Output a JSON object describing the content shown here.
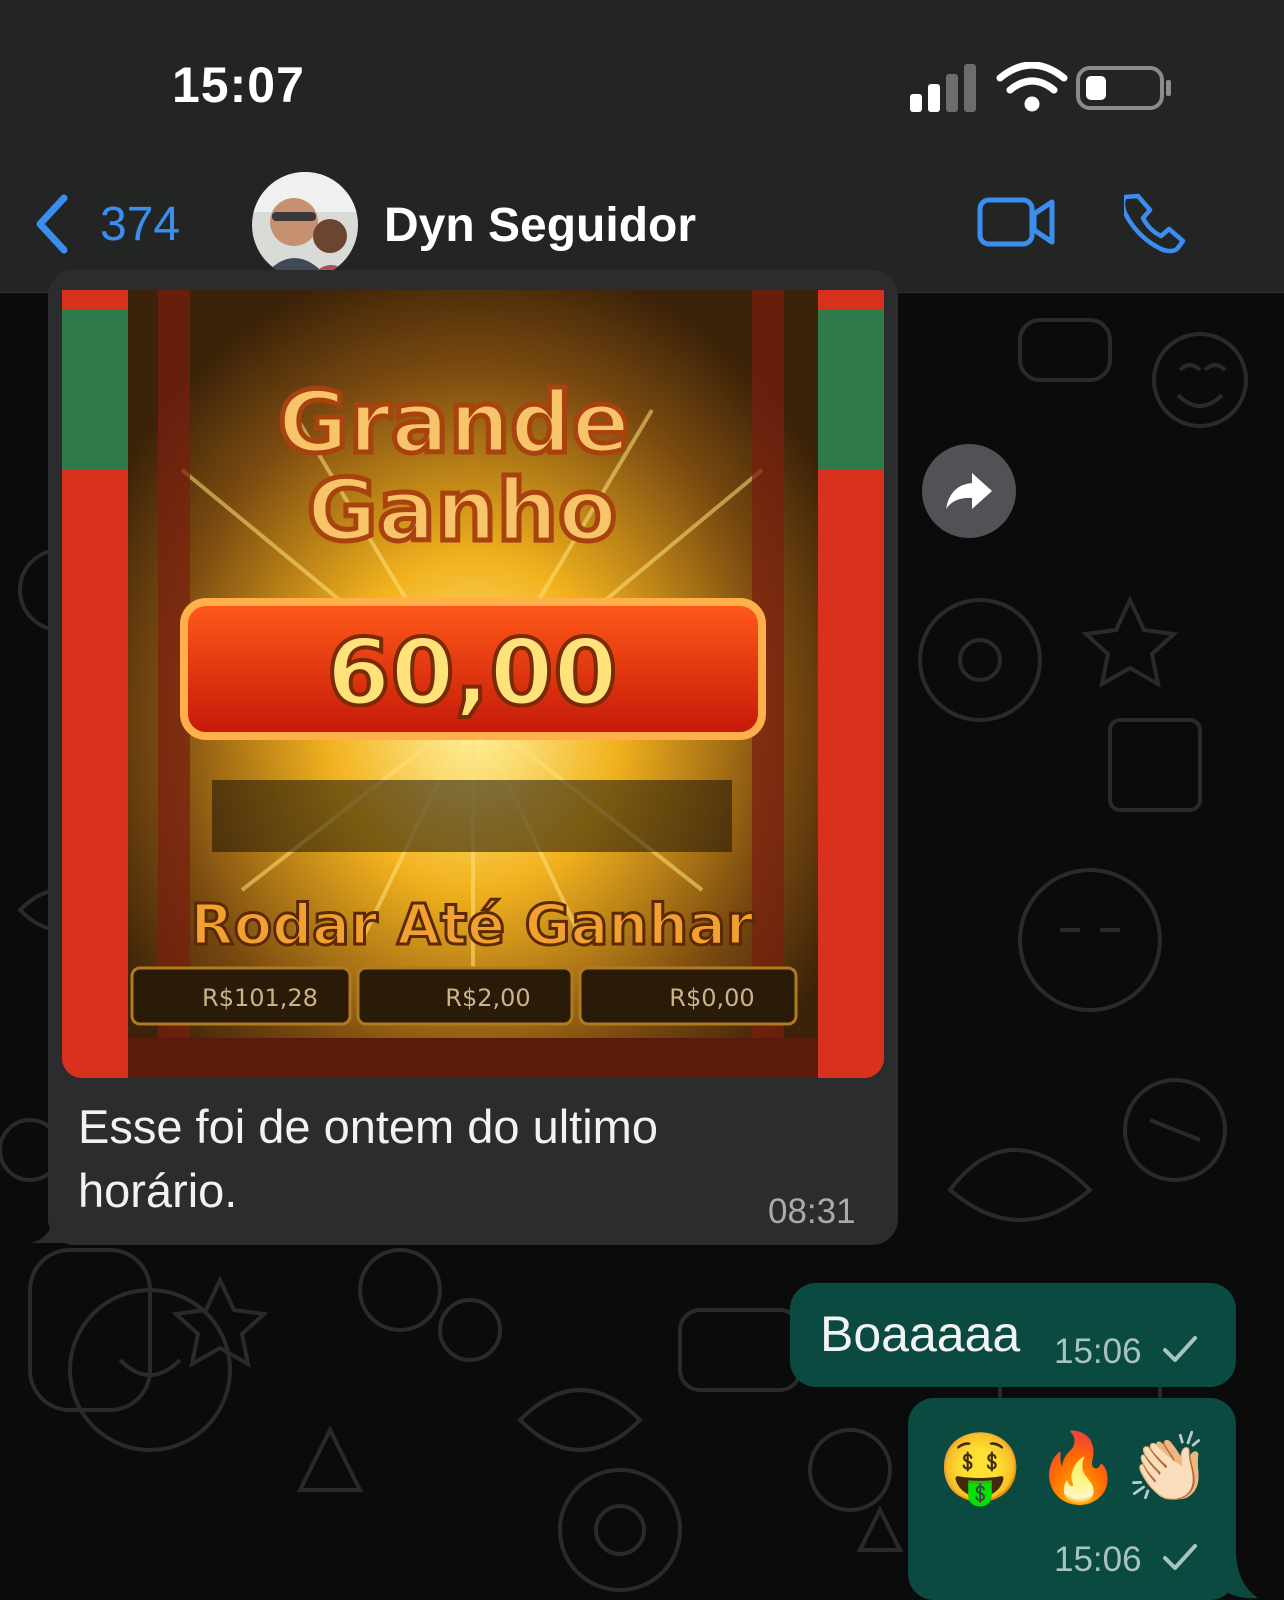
{
  "status_bar": {
    "time": "15:07"
  },
  "header": {
    "back_count": "374",
    "contact_name": "Dyn Seguidor"
  },
  "icons": {
    "back": "chevron-left-icon",
    "video": "video-camera-icon",
    "call": "phone-icon",
    "forward": "forward-arrow-icon",
    "read_receipt": "checkmark-icon"
  },
  "colors": {
    "accent": "#3b8ef0",
    "incoming_bubble": "#2b2c2e",
    "outgoing_bubble": "#0a4a41"
  },
  "messages": [
    {
      "direction": "incoming",
      "image": {
        "title_line1": "Grande",
        "title_line2": "Ganho",
        "win_amount": "60,00",
        "sub_text": "Rodar Até Ganhar",
        "balance_1": "R$101,28",
        "balance_2": "R$2,00",
        "balance_3": "R$0,00"
      },
      "text": "Esse foi de ontem do ultimo horário.",
      "time": "08:31"
    },
    {
      "direction": "outgoing",
      "text": "Boaaaaa",
      "time": "15:06"
    },
    {
      "direction": "outgoing",
      "emojis": [
        "🤑",
        "🔥",
        "👏🏻"
      ],
      "time": "15:06"
    }
  ]
}
